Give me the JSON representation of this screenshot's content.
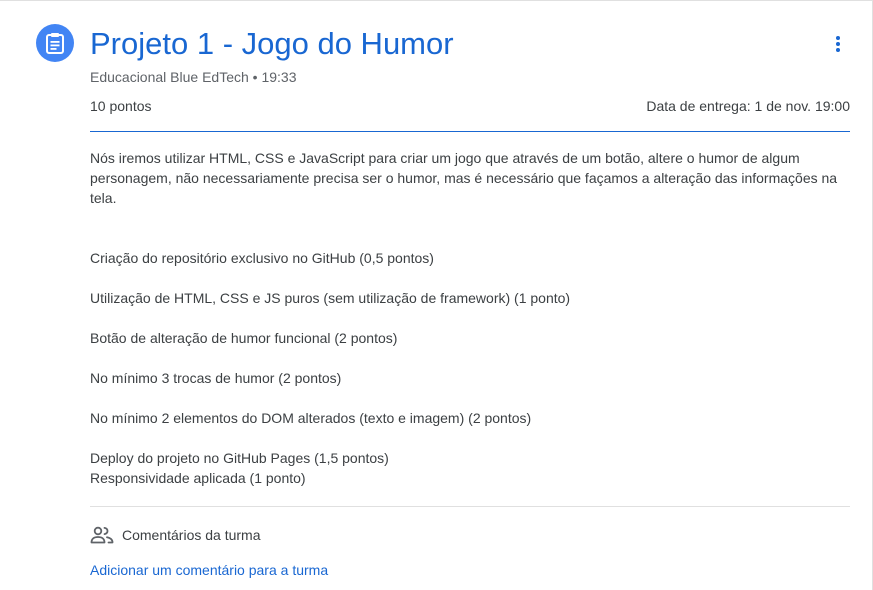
{
  "assignment": {
    "title": "Projeto 1 - Jogo do Humor",
    "author": "Educacional Blue EdTech",
    "separator": " • ",
    "time": "19:33",
    "points": "10 pontos",
    "due": "Data de entrega: 1 de nov. 19:00",
    "icon": "assignment-icon",
    "menu_icon": "more-vert-icon"
  },
  "description": "Nós iremos utilizar HTML, CSS e JavaScript para criar um jogo que através de um botão, altere o humor de algum personagem, não necessariamente precisa ser o humor, mas é necessário que façamos a alteração das informações na tela.",
  "criteria": [
    "Criação do repositório exclusivo no GitHub (0,5 pontos)",
    "Utilização de HTML, CSS e JS puros (sem utilização de framework) (1 ponto)",
    "Botão de alteração de humor funcional (2 pontos)",
    "No mínimo 3 trocas de humor (2 pontos)",
    "No mínimo 2 elementos do DOM alterados (texto e imagem) (2 pontos)",
    "Deploy do projeto no GitHub Pages (1,5 pontos)",
    "Responsividade aplicada (1 ponto)"
  ],
  "comments": {
    "label": "Comentários da turma",
    "icon": "people-icon",
    "add_label": "Adicionar um comentário para a turma"
  },
  "colors": {
    "accent": "#1967d2",
    "icon_bg": "#4285f4",
    "text": "#3c4043",
    "muted": "#5f6368"
  }
}
